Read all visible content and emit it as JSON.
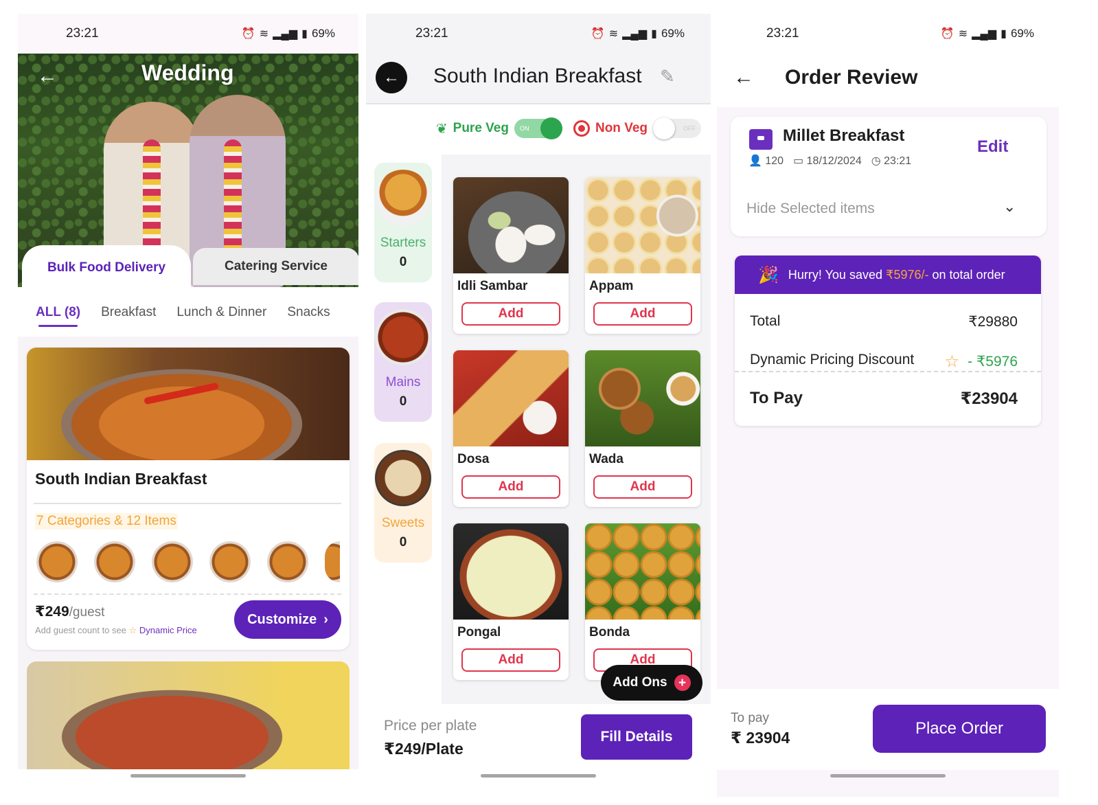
{
  "screen1": {
    "status": {
      "time": "23:21",
      "battery": "69%"
    },
    "header": {
      "title": "Wedding"
    },
    "service_tabs": [
      {
        "label": "Bulk Food Delivery",
        "active": true
      },
      {
        "label": "Catering Service",
        "active": false
      }
    ],
    "filters": [
      "ALL (8)",
      "Breakfast",
      "Lunch & Dinner",
      "Snacks"
    ],
    "package": {
      "name": "South Indian Breakfast",
      "categories_text": "7 Categories & 12 Items",
      "price": "₹249",
      "price_unit": "/guest",
      "hint_prefix": "Add guest count to see",
      "hint_highlight": "Dynamic Price",
      "customize_label": "Customize"
    }
  },
  "screen2": {
    "status": {
      "time": "23:21",
      "battery": "69%"
    },
    "header": {
      "title": "South Indian Breakfast"
    },
    "toggles": {
      "veg_label": "Pure Veg",
      "veg_state": "ON",
      "nonveg_label": "Non Veg",
      "nonveg_state": "OFF"
    },
    "side_categories": [
      {
        "label": "Starters",
        "count": "0"
      },
      {
        "label": "Mains",
        "count": "0"
      },
      {
        "label": "Sweets",
        "count": "0"
      }
    ],
    "items": [
      {
        "name": "Idli Sambar",
        "button": "Add"
      },
      {
        "name": "Appam",
        "button": "Add"
      },
      {
        "name": "Dosa",
        "button": "Add"
      },
      {
        "name": "Wada",
        "button": "Add"
      },
      {
        "name": "Pongal",
        "button": "Add"
      },
      {
        "name": "Bonda",
        "button": "Add"
      }
    ],
    "addons_label": "Add Ons",
    "footer": {
      "price_label": "Price per plate",
      "price_value": "₹249/Plate",
      "button": "Fill Details"
    }
  },
  "screen3": {
    "status": {
      "time": "23:21",
      "battery": "69%"
    },
    "header": {
      "title": "Order Review"
    },
    "order": {
      "name": "Millet Breakfast",
      "guests": "120",
      "date": "18/12/2024",
      "time": "23:21",
      "edit_label": "Edit",
      "toggle_label": "Hide Selected items"
    },
    "banner": {
      "prefix": "Hurry! You saved",
      "amount": "₹5976/-",
      "suffix": "on total order"
    },
    "bill": {
      "total_label": "Total",
      "total_value": "₹29880",
      "discount_label": "Dynamic Pricing Discount",
      "discount_value": "- ₹5976",
      "pay_label": "To Pay",
      "pay_value": "₹23904"
    },
    "footer": {
      "label": "To pay",
      "value": "₹ 23904",
      "button": "Place Order"
    }
  },
  "colors": {
    "brand_purple": "#5d22b8",
    "veg_green": "#2da44e",
    "nonveg_red": "#e0353a",
    "accent_orange": "#f2a43b",
    "add_red": "#e0354d"
  }
}
